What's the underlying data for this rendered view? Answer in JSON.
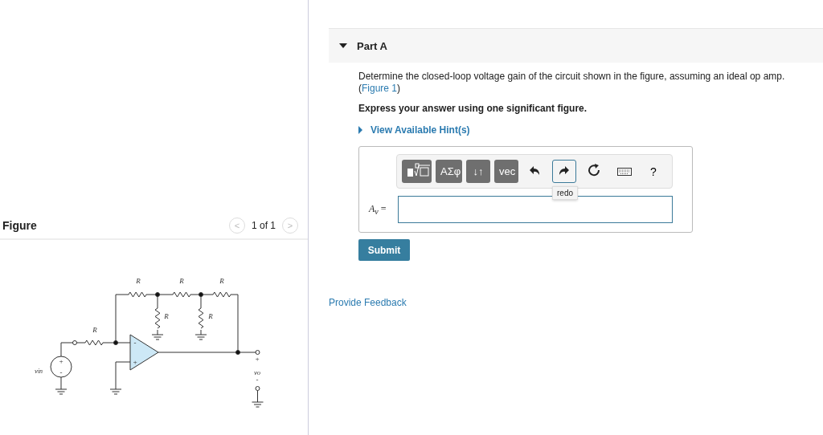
{
  "figure_panel": {
    "title": "Figure",
    "pager": {
      "prev": "<",
      "position": "1 of 1",
      "next": ">"
    },
    "labels": [
      "R",
      "R",
      "R",
      "R",
      "R",
      "R",
      "+",
      "-",
      "-",
      "+",
      "+",
      "-"
    ],
    "source_symbol": {
      "symbol": "v",
      "subscript": "in"
    },
    "output_symbol": {
      "symbol": "v",
      "subscript": "o"
    }
  },
  "part": {
    "title": "Part A",
    "expanded": true,
    "question": "Determine the closed-loop voltage gain of the circuit shown in the figure, assuming an ideal op amp.",
    "figure_ref": {
      "open": "(",
      "link": "Figure 1",
      "close": ")"
    },
    "instruction": "Express your answer using one significant figure.",
    "hint_link": "View Available Hint(s)",
    "toolbar": [
      {
        "kind": "templates",
        "highlighted": false
      },
      {
        "kind": "text",
        "label": "ΑΣφ",
        "highlighted": false
      },
      {
        "kind": "text",
        "label": "↓↑",
        "highlighted": false
      },
      {
        "kind": "text",
        "label": "vec",
        "highlighted": false
      },
      {
        "kind": "undo",
        "highlighted": false
      },
      {
        "kind": "redo",
        "highlighted": true,
        "tooltip": "redo"
      },
      {
        "kind": "reset",
        "highlighted": false
      },
      {
        "kind": "keyboard",
        "highlighted": false
      },
      {
        "kind": "help",
        "label": "?",
        "highlighted": false
      }
    ],
    "answer_label": {
      "symbol": "A",
      "subscript": "v",
      "sign": "="
    },
    "submit": "Submit"
  },
  "feedback_link": "Provide Feedback"
}
